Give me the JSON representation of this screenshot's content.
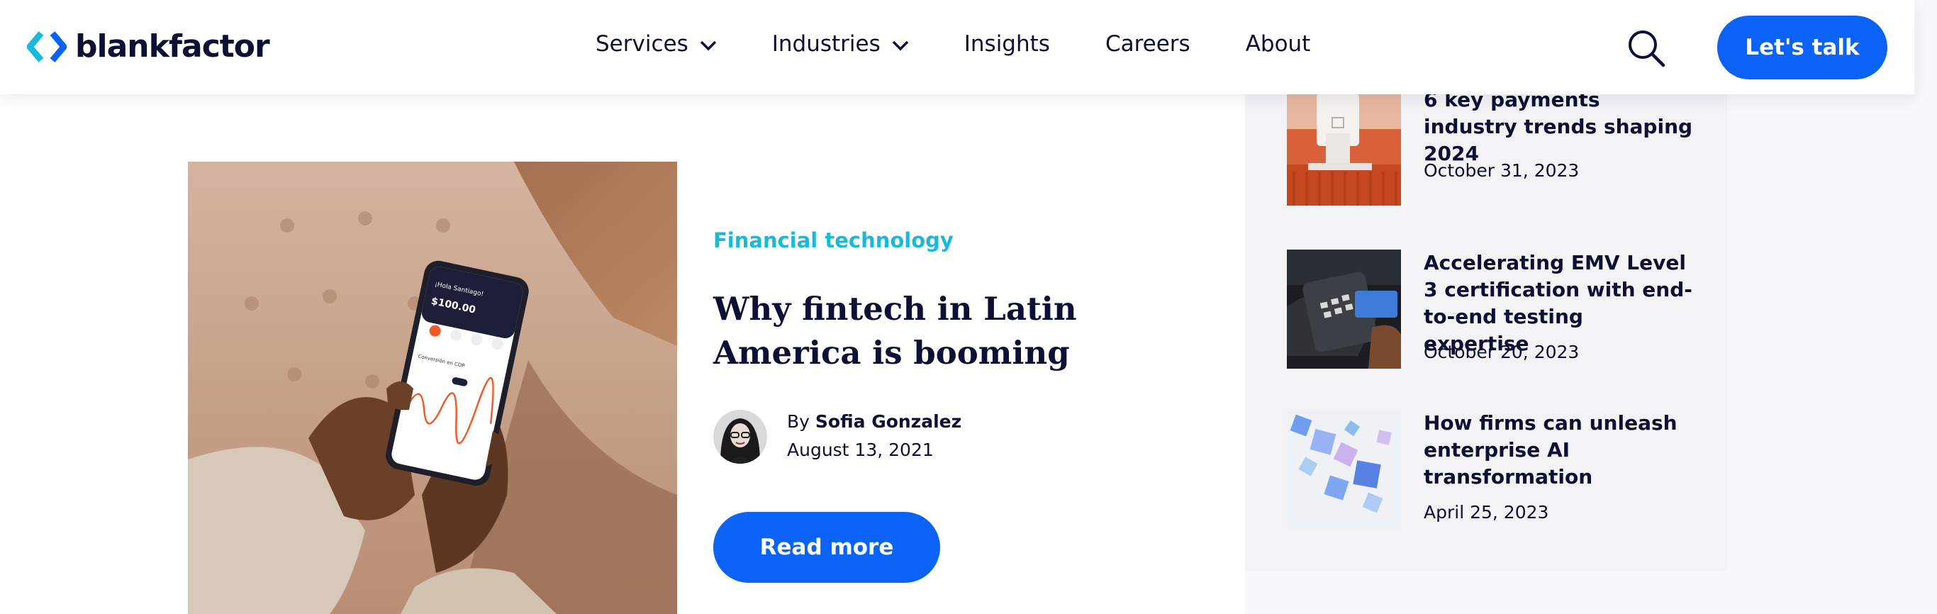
{
  "header": {
    "logo_text": "blankfactor",
    "nav": [
      {
        "label": "Services",
        "has_dropdown": true
      },
      {
        "label": "Industries",
        "has_dropdown": true
      },
      {
        "label": "Insights",
        "has_dropdown": false
      },
      {
        "label": "Careers",
        "has_dropdown": false
      },
      {
        "label": "About",
        "has_dropdown": false
      }
    ],
    "search_icon": "search-icon",
    "cta_label": "Let's talk"
  },
  "article": {
    "category": "Financial technology",
    "title": "Why fintech in Latin America is booming",
    "by": "By",
    "author": "Sofia Gonzalez",
    "date": "August 13, 2021",
    "read_more": "Read more",
    "phone": {
      "greeting": "¡Hola Santiago!",
      "balance": "$100.00",
      "label": "Conversión en COP"
    }
  },
  "sidebar": {
    "items": [
      {
        "title": "6 key payments industry trends shaping 2024",
        "date": "October 31, 2023"
      },
      {
        "title": "Accelerating EMV Level 3 certification with end-to-end testing expertise",
        "date": "October 20, 2023"
      },
      {
        "title": "How firms can unleash enterprise AI transformation",
        "date": "April 25, 2023"
      }
    ]
  },
  "colors": {
    "brand_blue": "#0a63f6",
    "accent_cyan": "#19b9d9",
    "text_navy": "#0d1034",
    "sidebar_bg": "#f3f3f6"
  }
}
